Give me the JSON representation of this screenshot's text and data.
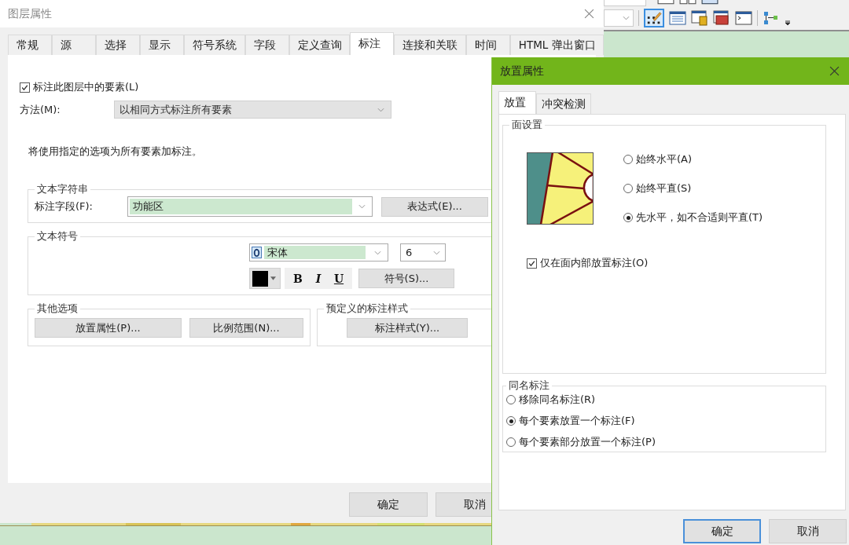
{
  "layer_properties": {
    "title": "图层属性",
    "tabs": [
      {
        "label": "常规",
        "selected": false
      },
      {
        "label": "源",
        "selected": false
      },
      {
        "label": "选择",
        "selected": false
      },
      {
        "label": "显示",
        "selected": false
      },
      {
        "label": "符号系统",
        "selected": false
      },
      {
        "label": "字段",
        "selected": false
      },
      {
        "label": "定义查询",
        "selected": false
      },
      {
        "label": "标注",
        "selected": true
      },
      {
        "label": "连接和关联",
        "selected": false
      },
      {
        "label": "时间",
        "selected": false
      },
      {
        "label": "HTML 弹出窗口",
        "selected": false
      }
    ],
    "label_features": {
      "label": "标注此图层中的要素(L)",
      "checked": true
    },
    "method": {
      "label": "方法(M):",
      "value": "以相同方式标注所有要素"
    },
    "description": "将使用指定的选项为所有要素加标注。",
    "text_string": {
      "title": "文本字符串",
      "field_label": "标注字段(F):",
      "field_value": "功能区",
      "expression_button": "表达式(E)..."
    },
    "text_symbol": {
      "title": "文本符号",
      "font": "宋体",
      "size": "6",
      "bold": "B",
      "italic": "I",
      "underline": "U",
      "symbol_button": "符号(S)..."
    },
    "other_options": {
      "title": "其他选项",
      "buttons": [
        "放置属性(P)...",
        "比例范围(N)..."
      ]
    },
    "predefined_styles": {
      "title": "预定义的标注样式",
      "button": "标注样式(Y)..."
    },
    "buttons": [
      "确定",
      "取消"
    ]
  },
  "placement_properties": {
    "title": "放置属性",
    "tabs": [
      {
        "label": "放置",
        "selected": true
      },
      {
        "label": "冲突检测",
        "selected": false
      }
    ],
    "polygon_settings": {
      "title": "面设置",
      "orientation": [
        {
          "label": "始终水平(A)",
          "selected": false
        },
        {
          "label": "始终平直(S)",
          "selected": false
        },
        {
          "label": "先水平，如不合适则平直(T)",
          "selected": true
        }
      ],
      "inside_only": {
        "label": "仅在面内部放置标注(O)",
        "checked": true
      }
    },
    "duplicate_labels": {
      "title": "同名标注",
      "options": [
        {
          "label": "移除同名标注(R)",
          "selected": false
        },
        {
          "label": "每个要素放置一个标注(F)",
          "selected": true
        },
        {
          "label": "每个要素部分放置一个标注(P)",
          "selected": false
        }
      ]
    },
    "buttons": [
      {
        "label": "确定",
        "focused": true
      },
      {
        "label": "取消",
        "focused": false
      }
    ]
  }
}
